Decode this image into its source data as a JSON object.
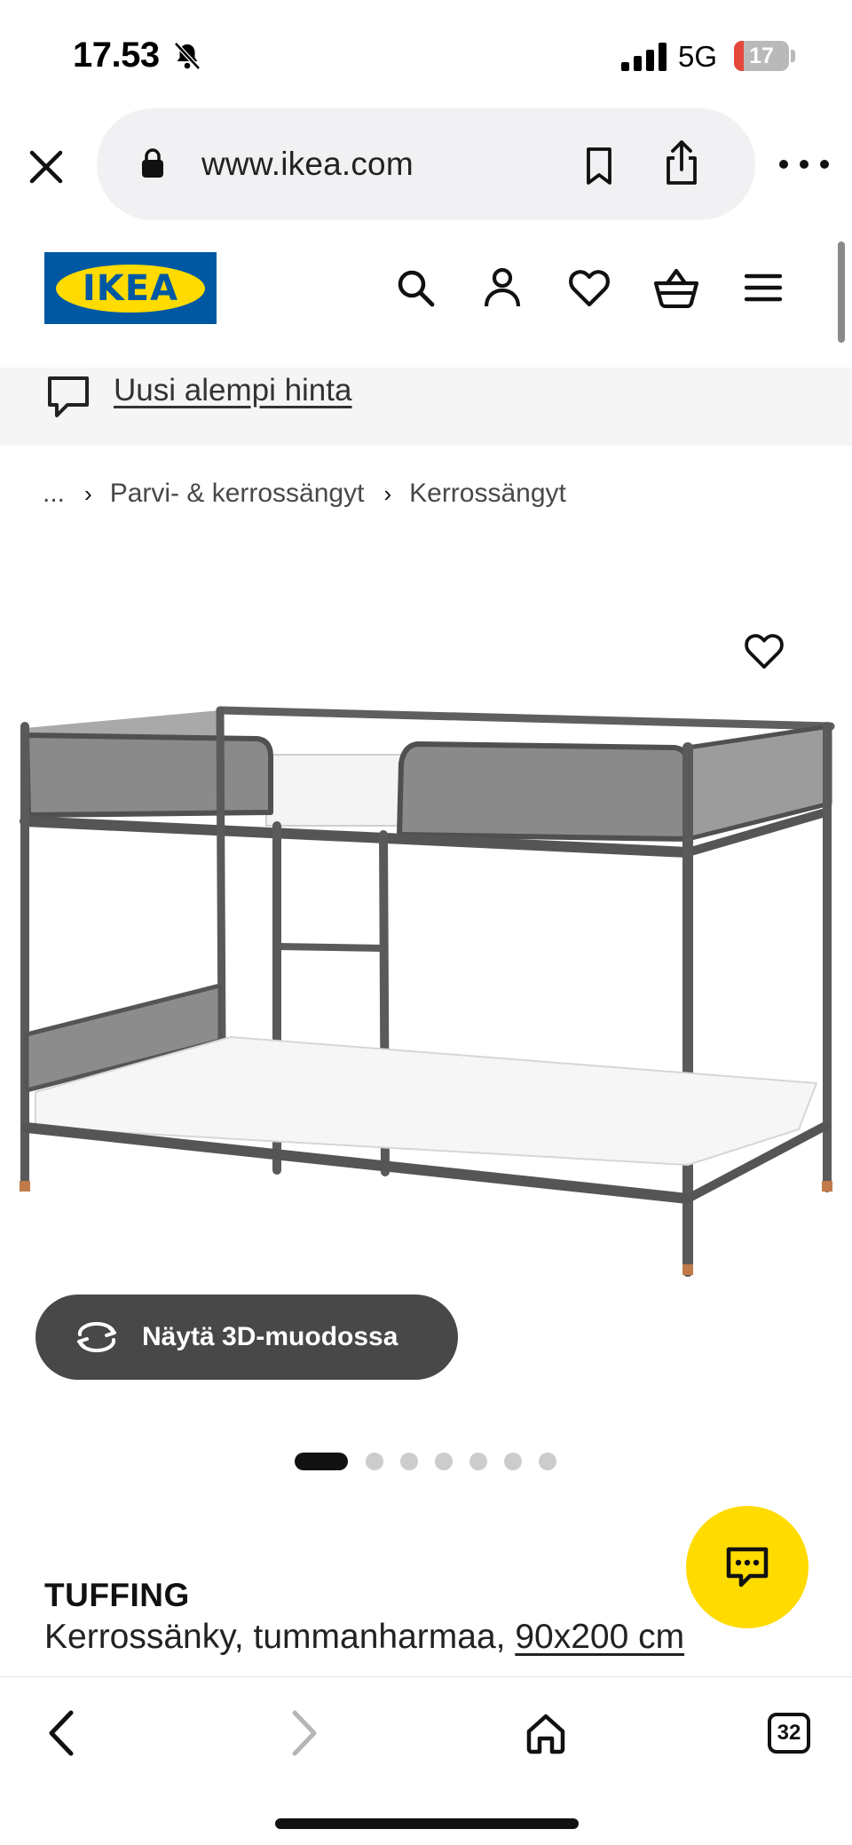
{
  "status_bar": {
    "time": "17.53",
    "network": "5G",
    "battery_level": "17",
    "battery_fraction": 0.17,
    "icons": [
      "bell-slash-icon",
      "signal-icon",
      "battery-icon"
    ]
  },
  "browser": {
    "url": "www.ikea.com",
    "open_tabs": "32",
    "icons": [
      "close-icon",
      "lock-icon",
      "bookmark-icon",
      "share-icon",
      "more-icon",
      "back-icon",
      "forward-icon",
      "home-icon",
      "tabs-icon"
    ]
  },
  "header": {
    "logo_text": "IKEA",
    "icons": [
      "search-icon",
      "account-icon",
      "heart-icon",
      "cart-icon",
      "menu-icon"
    ]
  },
  "banner": {
    "text": "Uusi alempi hinta",
    "icon": "chat-bubble-icon"
  },
  "breadcrumb": {
    "ellipsis": "...",
    "items": [
      "Parvi- & kerrossängyt",
      "Kerrossängyt"
    ]
  },
  "product": {
    "view_3d_label": "Näytä 3D-muodossa",
    "image_count": 7,
    "active_image": 1,
    "name": "TUFFING",
    "description": "Kerrossänky, tummanharmaa,",
    "size": "90x200 cm"
  },
  "colors": {
    "ikea_blue": "#0058a3",
    "ikea_yellow": "#ffdb00",
    "button_dark": "#484848",
    "banner_bg": "#f5f5f5"
  }
}
